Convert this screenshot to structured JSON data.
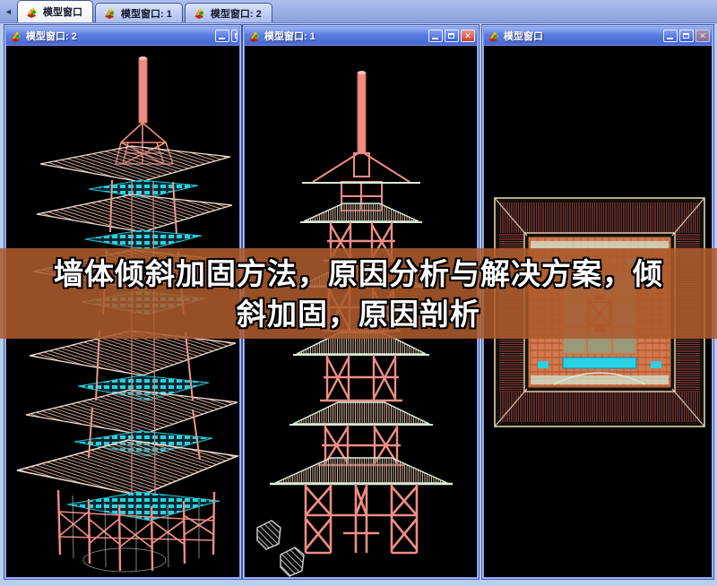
{
  "tab_bar": {
    "scroll_left_glyph": "◄",
    "tabs": [
      {
        "label": "模型窗口",
        "active": true
      },
      {
        "label": "模型窗口: 1",
        "active": false
      },
      {
        "label": "模型窗口: 2",
        "active": false
      }
    ]
  },
  "windows": {
    "left": {
      "title": "模型窗口: 2",
      "view": "3d-perspective-pagoda"
    },
    "middle": {
      "title": "模型窗口: 1",
      "view": "front-elevation-pagoda"
    },
    "right": {
      "title": "模型窗口",
      "view": "top-plan-pagoda"
    }
  },
  "window_controls": {
    "close_glyph": "✕"
  },
  "banner": {
    "line1": "墙体倾斜加固方法，原因分析与解决方案，倾",
    "line2": "斜加固，原因剖析"
  },
  "colors": {
    "wireframe_pink": "#ef8d85",
    "wireframe_pale": "#f2ddd0",
    "slab_cyan": "#2bd0e2",
    "eave_green": "#d8ecd8",
    "banner_overlay": "#ac5b2c",
    "titlebar_blue": "#4f70da",
    "viewport_black": "#000000"
  }
}
